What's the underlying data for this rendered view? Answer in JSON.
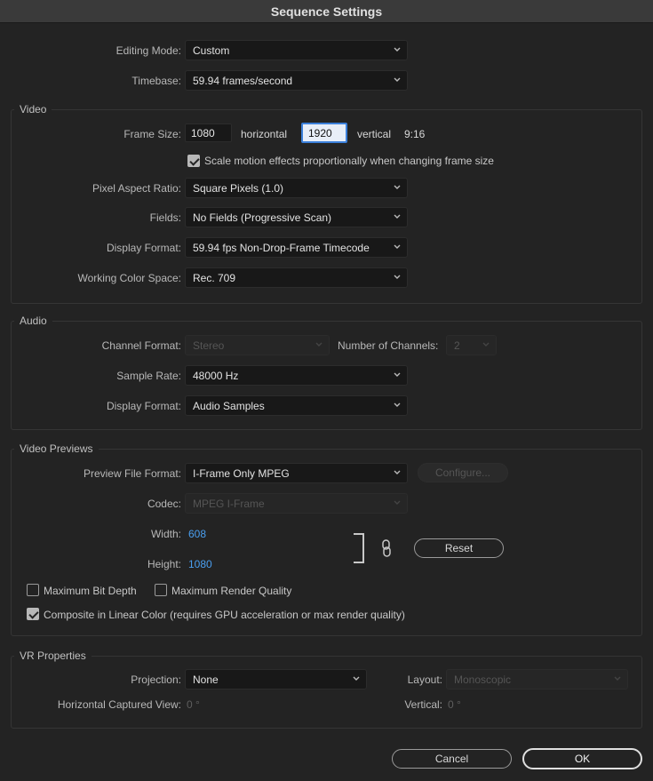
{
  "window": {
    "title": "Sequence Settings"
  },
  "general": {
    "editing_mode_label": "Editing Mode:",
    "editing_mode_value": "Custom",
    "timebase_label": "Timebase:",
    "timebase_value": "59.94  frames/second"
  },
  "video": {
    "section_label": "Video",
    "frame_size_label": "Frame Size:",
    "frame_width": "1080",
    "horizontal_label": "horizontal",
    "frame_height": "1920",
    "vertical_label": "vertical",
    "aspect_text": "9:16",
    "scale_checkbox_label": "Scale motion effects proportionally when changing frame size",
    "scale_checked": true,
    "pixel_aspect_label": "Pixel Aspect Ratio:",
    "pixel_aspect_value": "Square Pixels (1.0)",
    "fields_label": "Fields:",
    "fields_value": "No Fields (Progressive Scan)",
    "display_format_label": "Display Format:",
    "display_format_value": "59.94 fps Non-Drop-Frame Timecode",
    "color_space_label": "Working Color Space:",
    "color_space_value": "Rec. 709"
  },
  "audio": {
    "section_label": "Audio",
    "channel_format_label": "Channel Format:",
    "channel_format_value": "Stereo",
    "num_channels_label": "Number of Channels:",
    "num_channels_value": "2",
    "sample_rate_label": "Sample Rate:",
    "sample_rate_value": "48000 Hz",
    "display_format_label": "Display Format:",
    "display_format_value": "Audio Samples"
  },
  "previews": {
    "section_label": "Video Previews",
    "file_format_label": "Preview File Format:",
    "file_format_value": "I-Frame Only MPEG",
    "configure_label": "Configure...",
    "codec_label": "Codec:",
    "codec_value": "MPEG I-Frame",
    "width_label": "Width:",
    "width_value": "608",
    "height_label": "Height:",
    "height_value": "1080",
    "reset_label": "Reset",
    "max_bit_depth_label": "Maximum Bit Depth",
    "max_bit_depth_checked": false,
    "max_render_quality_label": "Maximum Render Quality",
    "max_render_quality_checked": false,
    "linear_color_label": "Composite in Linear Color (requires GPU acceleration or max render quality)",
    "linear_color_checked": true
  },
  "vr": {
    "section_label": "VR Properties",
    "projection_label": "Projection:",
    "projection_value": "None",
    "layout_label": "Layout:",
    "layout_value": "Monoscopic",
    "horizontal_view_label": "Horizontal Captured View:",
    "horizontal_view_value": "0 °",
    "vertical_label": "Vertical:",
    "vertical_value": "0 °"
  },
  "footer": {
    "cancel_label": "Cancel",
    "ok_label": "OK"
  }
}
